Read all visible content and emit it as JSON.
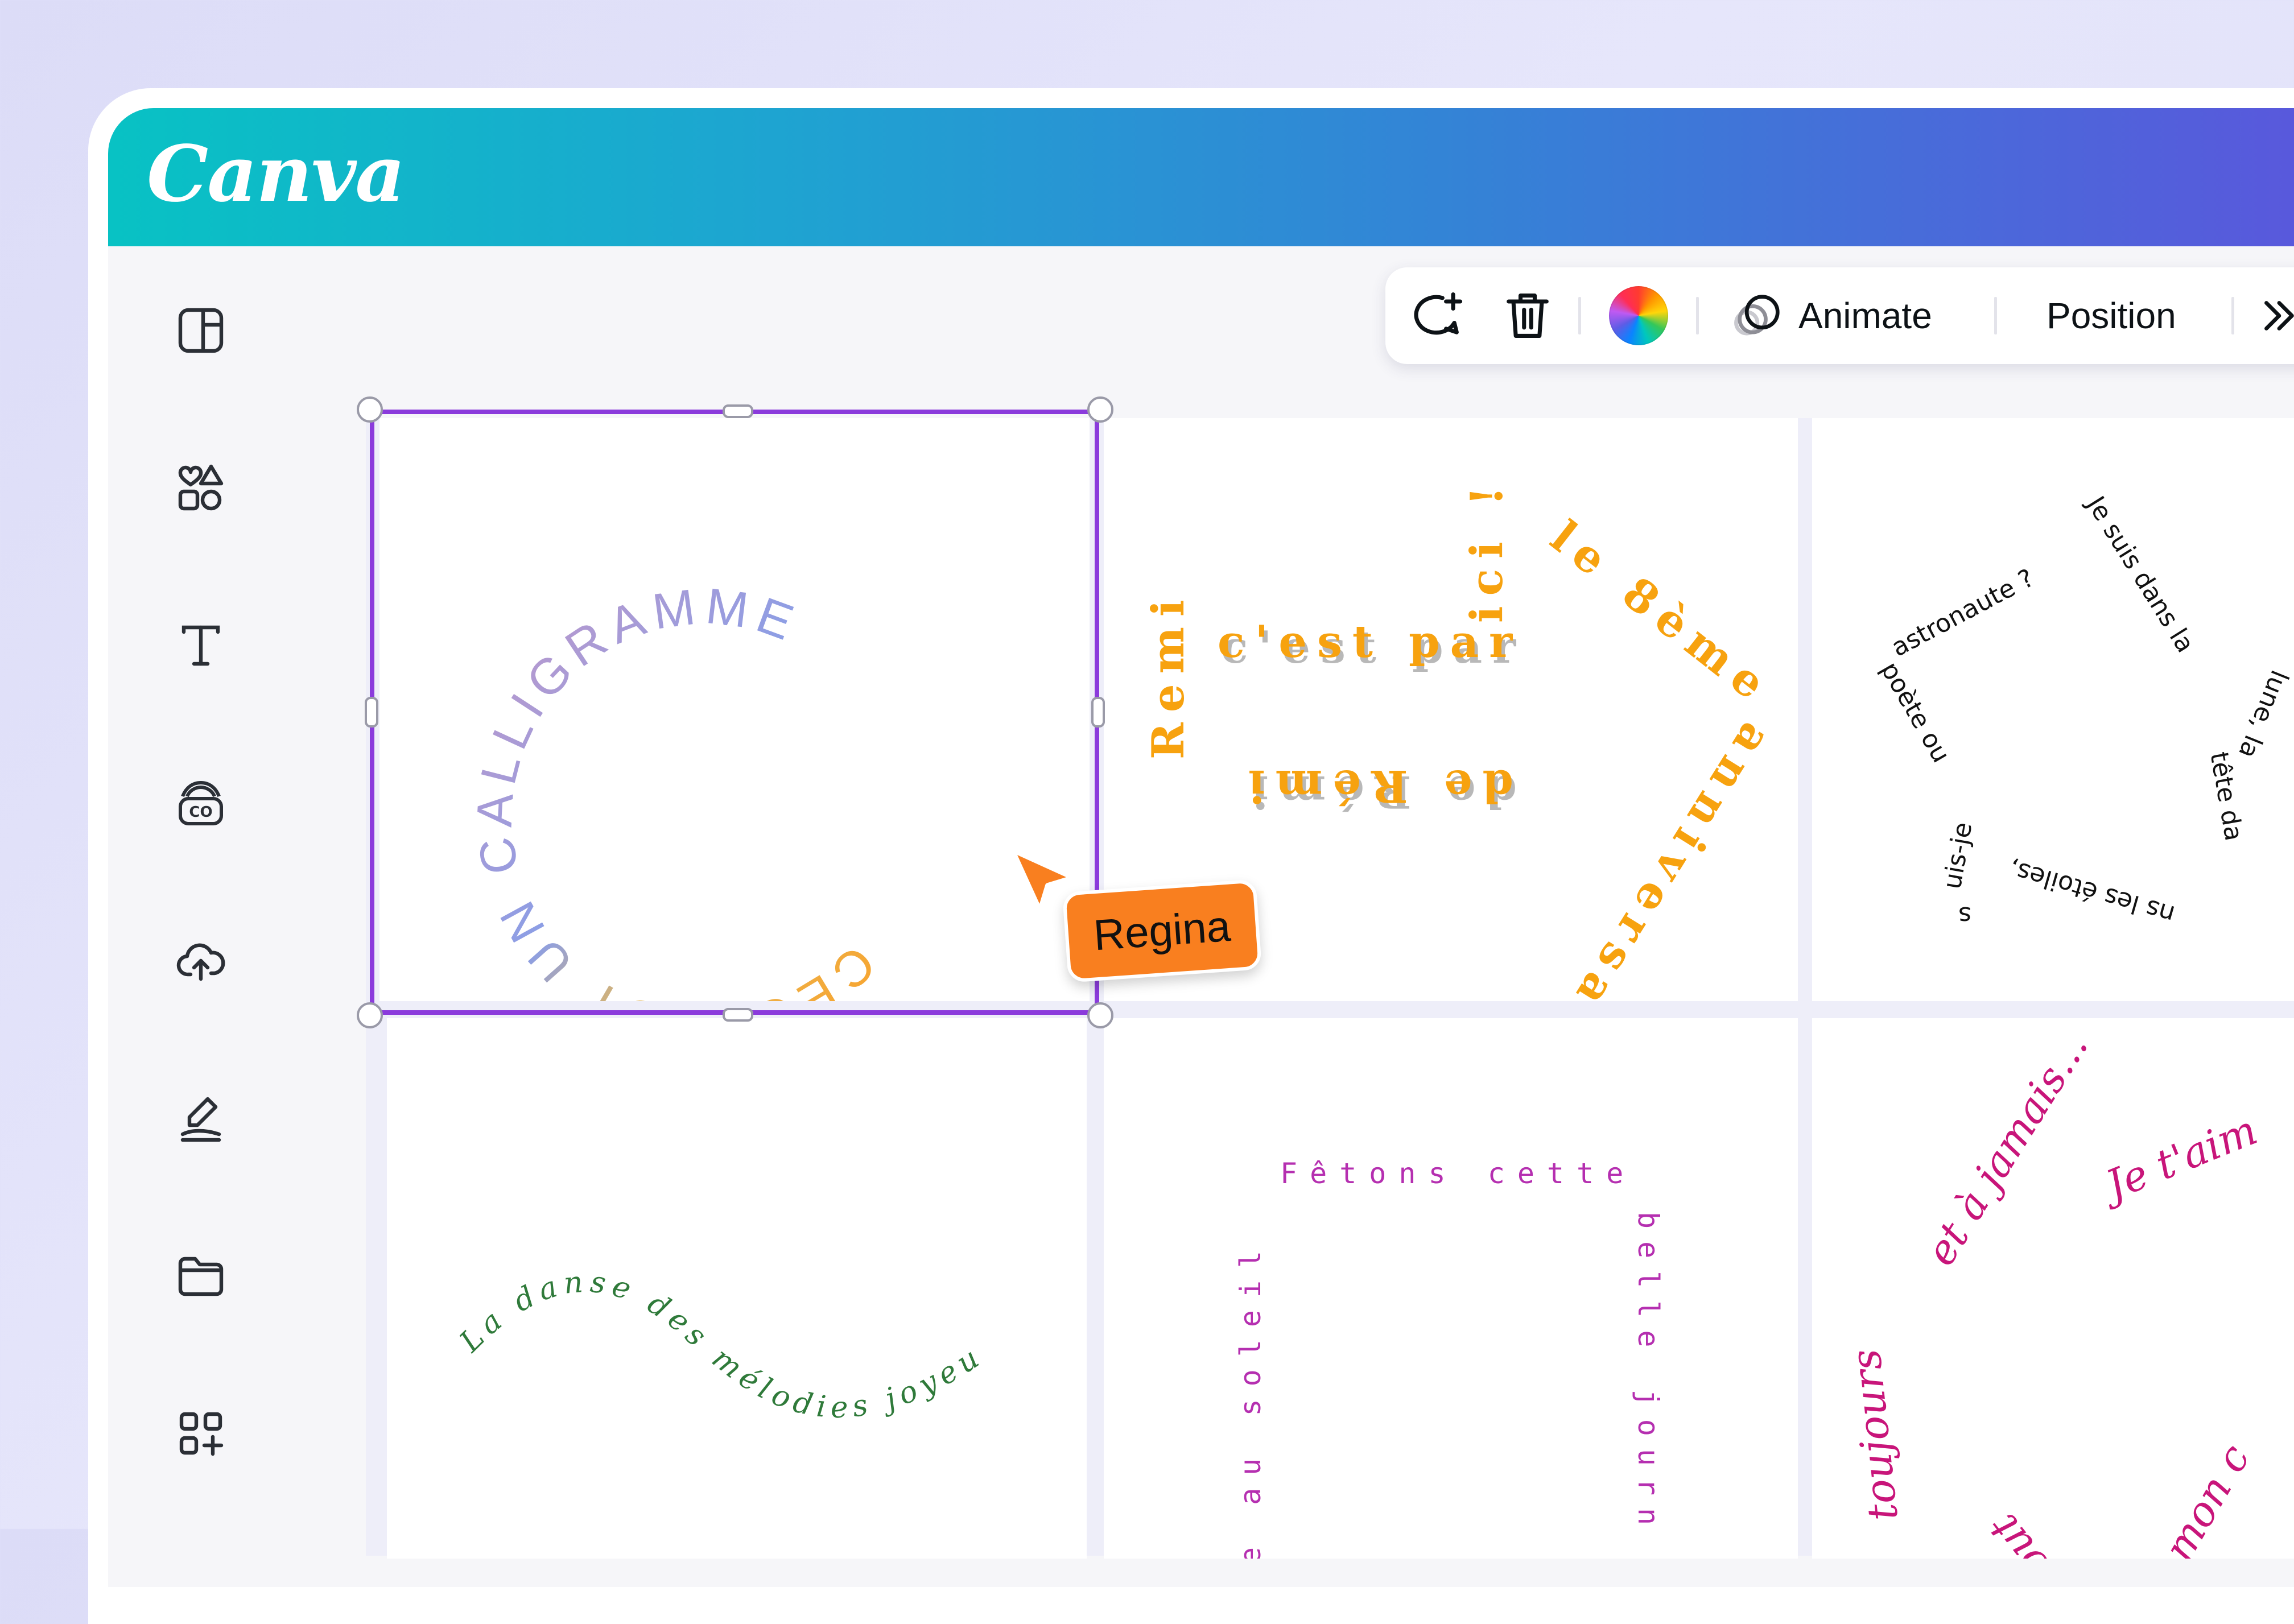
{
  "app": {
    "logo_text": "Canva",
    "brand_colors": [
      "#08c2c4",
      "#5a57dc"
    ]
  },
  "sidebar": {
    "items": [
      {
        "name": "design-icon"
      },
      {
        "name": "elements-icon"
      },
      {
        "name": "text-icon"
      },
      {
        "name": "brand-icon"
      },
      {
        "name": "uploads-icon"
      },
      {
        "name": "draw-icon"
      },
      {
        "name": "projects-folder-icon"
      },
      {
        "name": "apps-icon"
      }
    ]
  },
  "toolbar": {
    "comment_icon": "comment-add-icon",
    "delete_icon": "trash-icon",
    "color_icon": "color-wheel-icon",
    "animate_label": "Animate",
    "position_label": "Position",
    "more_icon": "chevron-right-double-icon"
  },
  "collaborator": {
    "name": "Regina",
    "color": "#f97f1f"
  },
  "selection_color": "#8b3bdc",
  "designs": {
    "circle": {
      "text": "CECI EST UN CALLIGRAMME"
    },
    "arrow": {
      "parts": [
        "Remi",
        "c'est par",
        "ici !",
        "le 8ème",
        "anniversaire",
        "de Rémi"
      ]
    },
    "star": {
      "text": "Je suis dans la lune, la tête dans les étoiles, suis-je poète ou astronaute ?",
      "parts": [
        "Je suis dans la",
        "lune, la",
        "tête da",
        "ns les étoiles,",
        "s",
        "uis-je",
        "poète ou",
        "astronaute ?"
      ]
    },
    "wave": {
      "text": "La danse des mélodies joyeuses"
    },
    "square": {
      "top": "Fêtons cette",
      "right": "belle journ",
      "left": "e au soleil"
    },
    "heart": {
      "text": "toujours et à jamais...Je t'aime mon cœur",
      "parts": [
        "Je t'aim",
        "et à jamais...",
        "toujours",
        "out",
        "mon c"
      ]
    }
  }
}
